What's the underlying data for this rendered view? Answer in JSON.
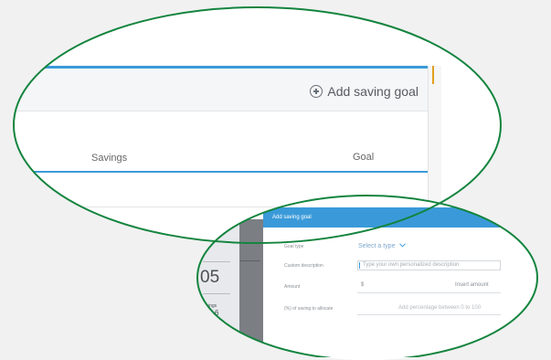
{
  "header": {
    "add_saving_goal_label": "Add saving goal"
  },
  "table": {
    "columns": [
      "Savings",
      "Goal"
    ]
  },
  "background_panel": {
    "number": "05",
    "label_small": "ings",
    "label_value": "6"
  },
  "modal": {
    "title": "Add saving goal",
    "goal_type": {
      "label": "Goal type",
      "value": "Select a type"
    },
    "custom_description": {
      "label": "Custom description",
      "placeholder": "Type your own personalized description"
    },
    "amount": {
      "label": "Amount",
      "currency": "$",
      "placeholder": "Insert amount"
    },
    "allocate": {
      "label": "(%) of saving to allocate",
      "placeholder": "Add percentage between 0 to 100"
    }
  },
  "colors": {
    "accent": "#3a9ad9",
    "callout_outline": "#13843e",
    "scroll_thumb": "#e0a020"
  }
}
